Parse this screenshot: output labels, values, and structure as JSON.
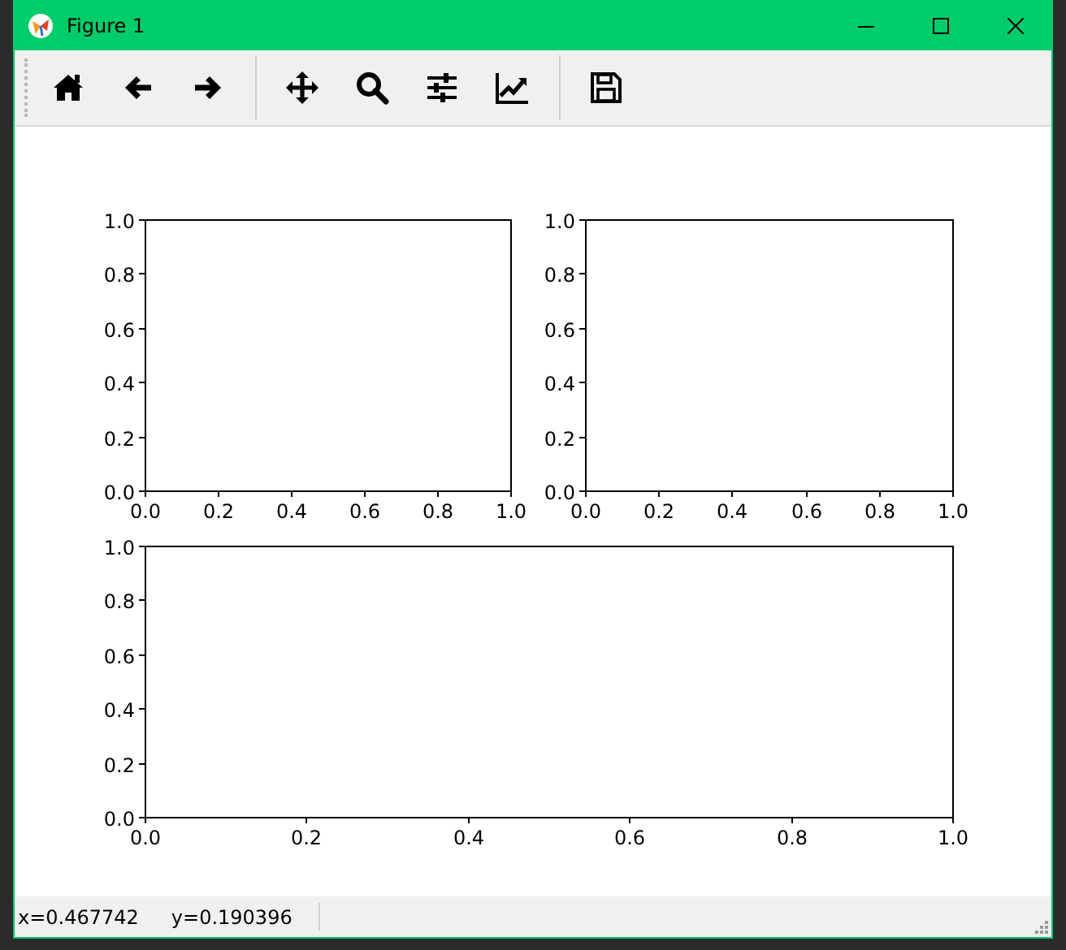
{
  "window": {
    "title": "Figure 1"
  },
  "toolbar": [
    {
      "kind": "home"
    },
    {
      "kind": "back"
    },
    {
      "kind": "forward"
    },
    {
      "kind": "separator"
    },
    {
      "kind": "pan"
    },
    {
      "kind": "zoom"
    },
    {
      "kind": "configure"
    },
    {
      "kind": "chart"
    },
    {
      "kind": "separator"
    },
    {
      "kind": "save"
    }
  ],
  "figure": {
    "axes": [
      {
        "chart_data": {
          "type": "line",
          "xlim": [
            0,
            1
          ],
          "ylim": [
            0,
            1
          ],
          "xticks": [
            {
              "value": 0,
              "label": "0.0"
            },
            {
              "value": 0.2,
              "label": "0.2"
            },
            {
              "value": 0.4,
              "label": "0.4"
            },
            {
              "value": 0.6,
              "label": "0.6"
            },
            {
              "value": 0.8,
              "label": "0.8"
            },
            {
              "value": 1,
              "label": "1.0"
            }
          ],
          "yticks": [
            {
              "value": 0,
              "label": "0.0"
            },
            {
              "value": 0.2,
              "label": "0.2"
            },
            {
              "value": 0.4,
              "label": "0.4"
            },
            {
              "value": 0.6,
              "label": "0.6"
            },
            {
              "value": 0.8,
              "label": "0.8"
            },
            {
              "value": 1,
              "label": "1.0"
            }
          ]
        }
      },
      {
        "chart_data": {
          "type": "line",
          "xlim": [
            0,
            1
          ],
          "ylim": [
            0,
            1
          ],
          "xticks": [
            {
              "value": 0,
              "label": "0.0"
            },
            {
              "value": 0.2,
              "label": "0.2"
            },
            {
              "value": 0.4,
              "label": "0.4"
            },
            {
              "value": 0.6,
              "label": "0.6"
            },
            {
              "value": 0.8,
              "label": "0.8"
            },
            {
              "value": 1,
              "label": "1.0"
            }
          ],
          "yticks": [
            {
              "value": 0,
              "label": "0.0"
            },
            {
              "value": 0.2,
              "label": "0.2"
            },
            {
              "value": 0.4,
              "label": "0.4"
            },
            {
              "value": 0.6,
              "label": "0.6"
            },
            {
              "value": 0.8,
              "label": "0.8"
            },
            {
              "value": 1,
              "label": "1.0"
            }
          ]
        }
      },
      {
        "chart_data": {
          "type": "line",
          "xlim": [
            0,
            1
          ],
          "ylim": [
            0,
            1
          ],
          "xticks": [
            {
              "value": 0,
              "label": "0.0"
            },
            {
              "value": 0.2,
              "label": "0.2"
            },
            {
              "value": 0.4,
              "label": "0.4"
            },
            {
              "value": 0.6,
              "label": "0.6"
            },
            {
              "value": 0.8,
              "label": "0.8"
            },
            {
              "value": 1,
              "label": "1.0"
            }
          ],
          "yticks": [
            {
              "value": 0,
              "label": "0.0"
            },
            {
              "value": 0.2,
              "label": "0.2"
            },
            {
              "value": 0.4,
              "label": "0.4"
            },
            {
              "value": 0.6,
              "label": "0.6"
            },
            {
              "value": 0.8,
              "label": "0.8"
            },
            {
              "value": 1,
              "label": "1.0"
            }
          ]
        }
      }
    ]
  },
  "status_bar": {
    "x": "x=0.467742",
    "y": "y=0.190396"
  }
}
